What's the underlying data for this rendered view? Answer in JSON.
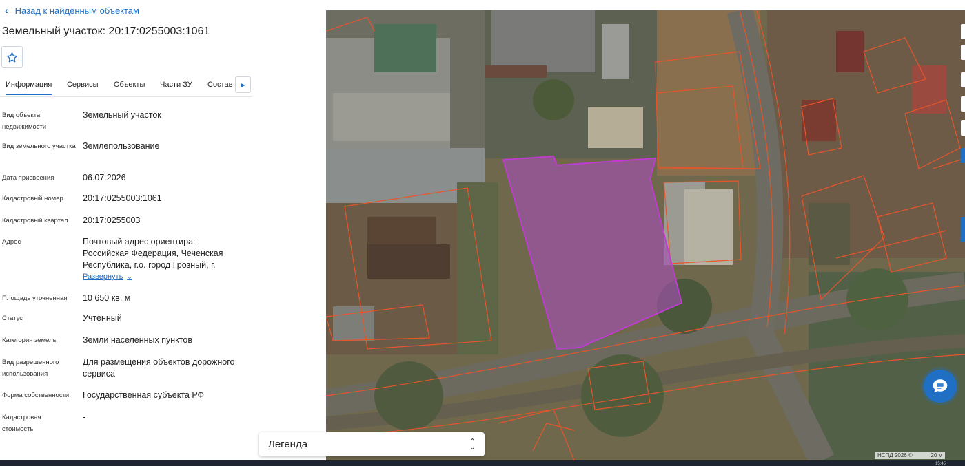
{
  "header": {
    "back_label": "Назад к найденным объектам",
    "title": "Земельный участок: 20:17:0255003:1061"
  },
  "tabs": [
    {
      "label": "Информация"
    },
    {
      "label": "Сервисы"
    },
    {
      "label": "Объекты"
    },
    {
      "label": "Части ЗУ"
    },
    {
      "label": "Состав"
    }
  ],
  "properties": {
    "type": {
      "label": "Вид объекта недвижимости",
      "value": "Земельный участок"
    },
    "land_kind": {
      "label": "Вид земельного участка",
      "value": "Землепользование"
    },
    "date": {
      "label": "Дата присвоения",
      "value": "06.07.2026"
    },
    "cadnum": {
      "label": "Кадастровый номер",
      "value": "20:17:0255003:1061"
    },
    "quarter": {
      "label": "Кадастровый квартал",
      "value": "20:17:0255003"
    },
    "address": {
      "label": "Адрес",
      "value": "Почтовый адрес ориентира: Российская Федерация, Чеченская Республика, г.о. город Грозный, г.",
      "expand_label": "Развернуть"
    },
    "area": {
      "label": "Площадь уточненная",
      "value": "10 650 кв. м"
    },
    "status": {
      "label": "Статус",
      "value": "Учтенный"
    },
    "category": {
      "label": "Категория земель",
      "value": "Земли населенных пунктов"
    },
    "permitted": {
      "label": "Вид разрешенного использования",
      "value": "Для размещения объектов дорожного сервиса"
    },
    "ownership": {
      "label": "Форма собственности",
      "value": "Государственная субъекта РФ"
    },
    "cost": {
      "label": "Кадастровая стоимость",
      "value": "-"
    }
  },
  "map": {
    "legend_label": "Легенда",
    "attribution": "НСПД 2026 ©",
    "scale": "20 м",
    "selected_parcel_color": "#a64fb7",
    "parcel_border_color": "#e8552a"
  },
  "taskbar": {
    "clock": "15:45"
  },
  "icons": {
    "back": "chevron-left-icon",
    "favorite": "star-icon",
    "tab_scroll": "chevron-right-icon",
    "expand": "chevron-down-icon",
    "legend": "updown-chevron-icon",
    "chat": "chat-icon"
  }
}
